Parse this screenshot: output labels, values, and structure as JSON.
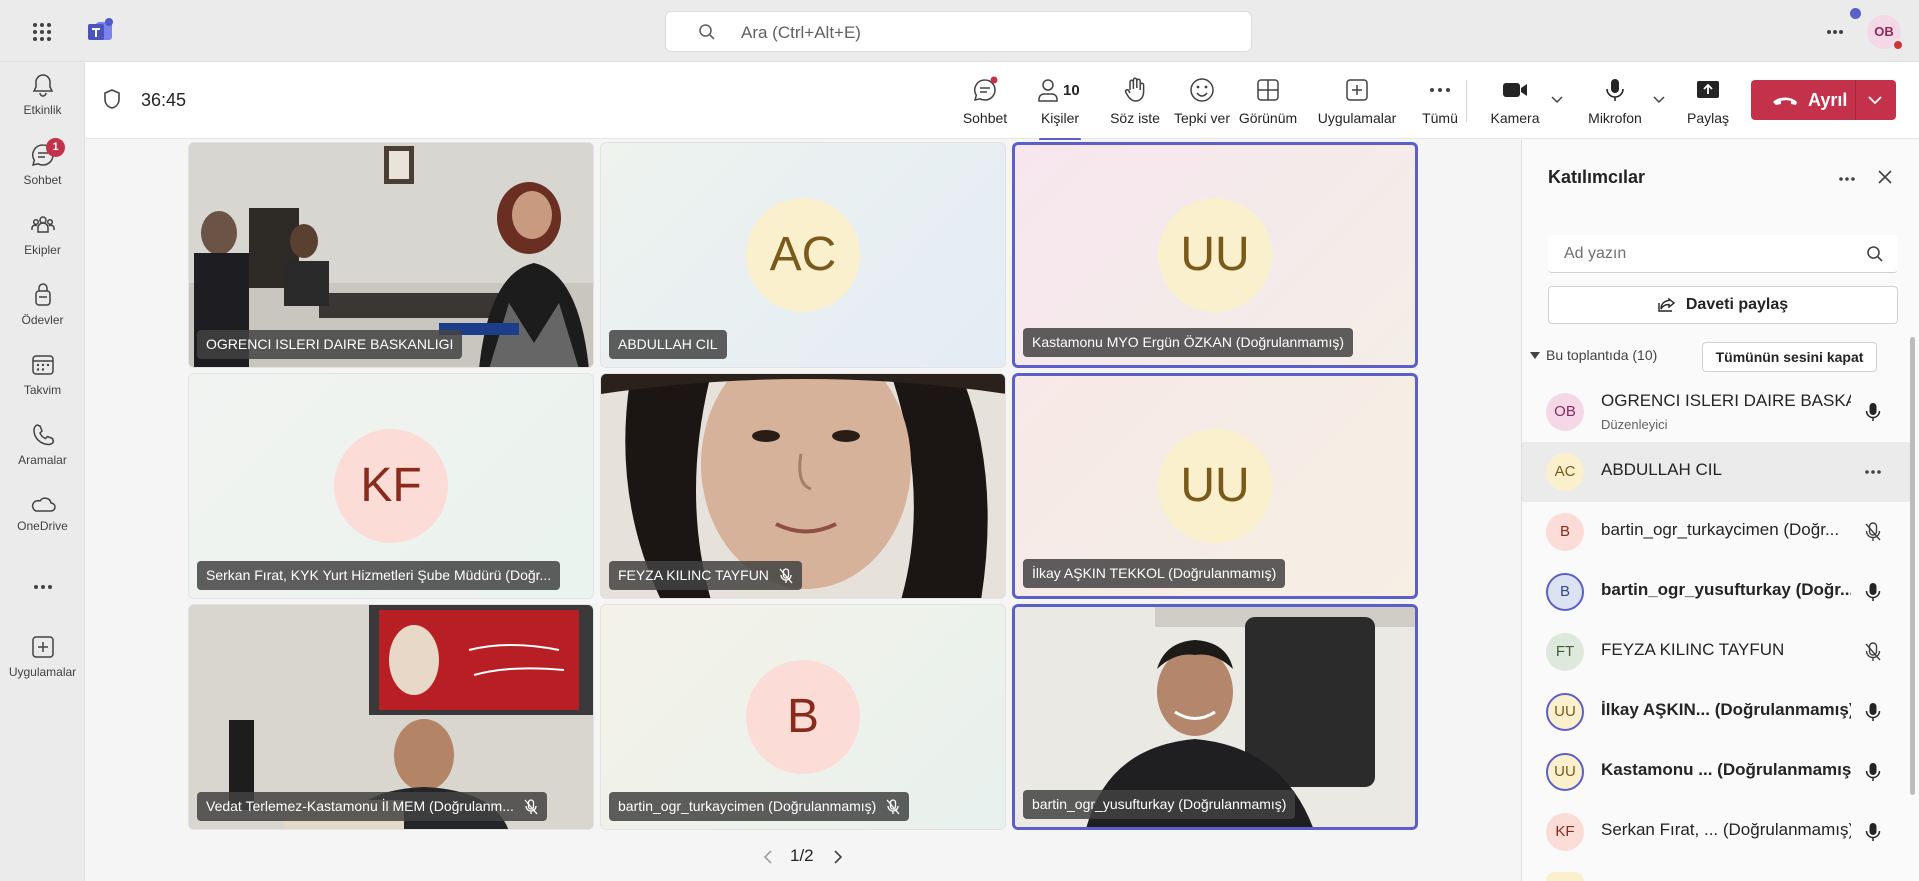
{
  "search": {
    "placeholder": "Ara (Ctrl+Alt+E)"
  },
  "profile": {
    "initials": "OB"
  },
  "rail": [
    {
      "label": "Etkinlik",
      "icon": "bell-icon"
    },
    {
      "label": "Sohbet",
      "icon": "chat-icon",
      "badge": "1"
    },
    {
      "label": "Ekipler",
      "icon": "teams-icon"
    },
    {
      "label": "Ödevler",
      "icon": "assignments-icon"
    },
    {
      "label": "Takvim",
      "icon": "calendar-icon"
    },
    {
      "label": "Aramalar",
      "icon": "phone-icon"
    },
    {
      "label": "OneDrive",
      "icon": "cloud-icon"
    },
    {
      "label": "Uygulamalar",
      "icon": "add-apps-icon"
    }
  ],
  "meeting": {
    "timer": "36:45",
    "toolbar": {
      "chat": "Sohbet",
      "people": "Kişiler",
      "people_count": "10",
      "raise": "Söz iste",
      "react": "Tepki ver",
      "view": "Görünüm",
      "apps": "Uygulamalar",
      "more": "Tümü",
      "camera": "Kamera",
      "mic": "Mikrofon",
      "share": "Paylaş",
      "leave": "Ayrıl"
    }
  },
  "tiles": [
    {
      "name": "OGRENCI ISLERI DAIRE BASKANLIGI",
      "type": "video"
    },
    {
      "name": "ABDULLAH CIL",
      "initials": "AC"
    },
    {
      "name": "Kastamonu MYO Ergün ÖZKAN (Doğrulanmamış)",
      "initials": "UU"
    },
    {
      "name": "Serkan Fırat, KYK Yurt Hizmetleri Şube Müdürü (Doğr...",
      "initials": "KF"
    },
    {
      "name": "FEYZA KILINC TAYFUN",
      "type": "video"
    },
    {
      "name": "İlkay AŞKIN TEKKOL (Doğrulanmamış)",
      "initials": "UU"
    },
    {
      "name": "Vedat Terlemez-Kastamonu İl MEM (Doğrulanm...",
      "type": "video"
    },
    {
      "name": "bartin_ogr_turkaycimen (Doğrulanmamış)",
      "initials": "B"
    },
    {
      "name": "bartin_ogr_yusufturkay (Doğrulanmamış)",
      "type": "video"
    }
  ],
  "pager": "1/2",
  "panel": {
    "title": "Katılımcılar",
    "search_placeholder": "Ad yazın",
    "invite": "Daveti paylaş",
    "section": "Bu toplantıda (10)",
    "mute_all": "Tümünün sesini kapat",
    "people": [
      {
        "initials": "OB",
        "name": "OGRENCI ISLERI DAIRE BASKA...",
        "role": "Düzenleyici",
        "mic": "on"
      },
      {
        "initials": "AC",
        "name": "ABDULLAH CIL",
        "mic": "more"
      },
      {
        "initials": "B",
        "name": "bartin_ogr_turkaycimen (Doğr...",
        "mic": "off"
      },
      {
        "initials": "B",
        "name": "bartin_ogr_yusufturkay (Doğr...",
        "mic": "on"
      },
      {
        "initials": "FT",
        "name": "FEYZA KILINC TAYFUN",
        "mic": "off"
      },
      {
        "initials": "UU",
        "name": "İlkay AŞKIN... (Doğrulanmamış)",
        "mic": "on"
      },
      {
        "initials": "UU",
        "name": "Kastamonu ... (Doğrulanmamış)",
        "mic": "on"
      },
      {
        "initials": "KF",
        "name": "Serkan Fırat, ... (Doğrulanmamış)",
        "mic": "on"
      }
    ]
  },
  "colors": {
    "accent": "#5b5fc7",
    "leave": "#c4314b"
  }
}
